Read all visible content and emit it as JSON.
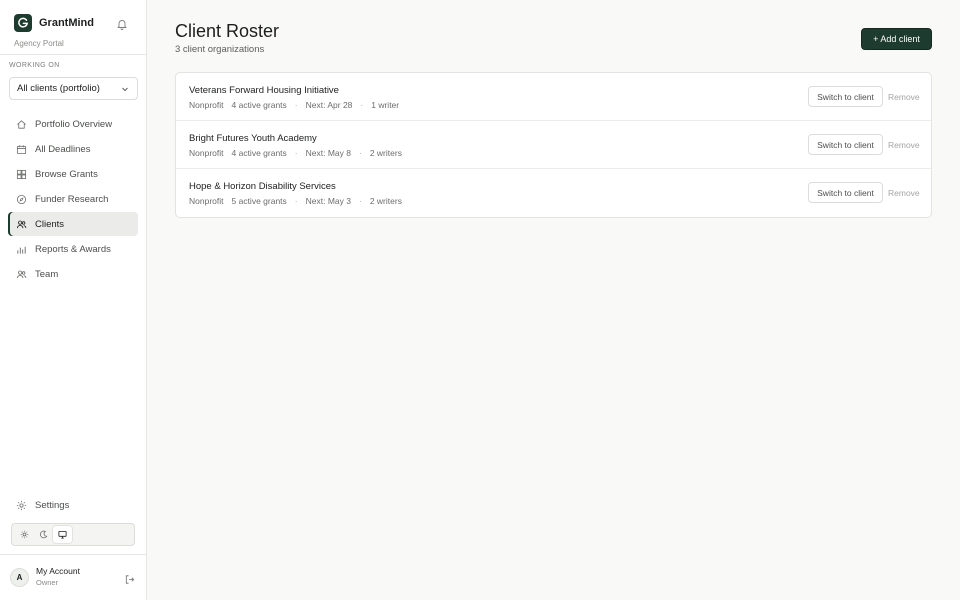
{
  "app": {
    "name": "GrantMind",
    "portal": "Agency Portal"
  },
  "workspace": {
    "label": "WORKING ON",
    "selected": "All clients (portfolio)"
  },
  "nav": {
    "items": [
      {
        "label": "Portfolio Overview",
        "icon": "home-icon"
      },
      {
        "label": "All Deadlines",
        "icon": "calendar-icon"
      },
      {
        "label": "Browse Grants",
        "icon": "grid-icon"
      },
      {
        "label": "Funder Research",
        "icon": "compass-icon"
      },
      {
        "label": "Clients",
        "icon": "users-icon",
        "active": true
      },
      {
        "label": "Reports & Awards",
        "icon": "bar-chart-icon"
      },
      {
        "label": "Team",
        "icon": "team-icon"
      }
    ],
    "settings": "Settings"
  },
  "theme": {
    "options": [
      "light",
      "dark",
      "system"
    ],
    "selected": "system"
  },
  "account": {
    "initial": "A",
    "name": "My Account",
    "role": "Owner"
  },
  "page": {
    "title": "Client Roster",
    "subtitle": "3 client organizations",
    "add_button": "+ Add client"
  },
  "clients": [
    {
      "name": "Veterans Forward Housing Initiative",
      "type": "Nonprofit",
      "grants": "4 active grants",
      "next": "Next: Apr 28",
      "writers": "1 writer"
    },
    {
      "name": "Bright Futures Youth Academy",
      "type": "Nonprofit",
      "grants": "4 active grants",
      "next": "Next: May 8",
      "writers": "2 writers"
    },
    {
      "name": "Hope & Horizon Disability Services",
      "type": "Nonprofit",
      "grants": "5 active grants",
      "next": "Next: May 3",
      "writers": "2 writers"
    }
  ],
  "row_actions": {
    "switch": "Switch to client",
    "remove": "Remove",
    "separator": "·"
  },
  "colors": {
    "brand": "#1d3b2e",
    "background": "#f9f9f7"
  }
}
